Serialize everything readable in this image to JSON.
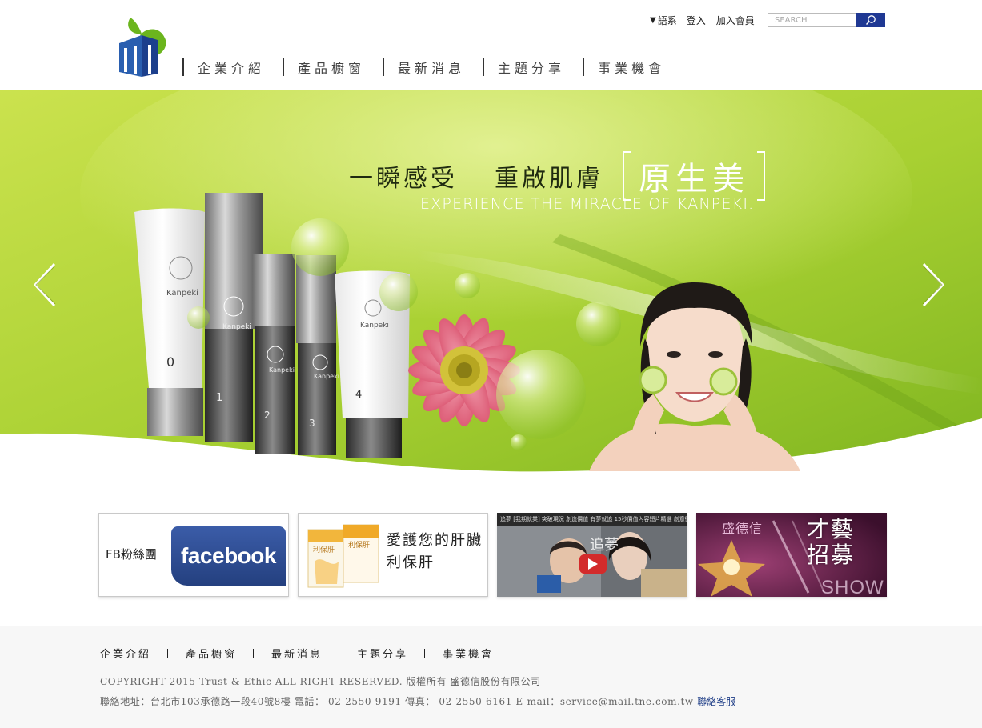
{
  "header": {
    "lang_label": "語系",
    "login_label": "登入",
    "join_label": "加入會員",
    "search_placeholder": "SEARCH"
  },
  "nav": {
    "items": [
      {
        "label": "企業介紹"
      },
      {
        "label": "產品櫥窗"
      },
      {
        "label": "最新消息"
      },
      {
        "label": "主題分享"
      },
      {
        "label": "事業機會"
      }
    ]
  },
  "banner": {
    "headline_1": "一瞬感受",
    "headline_2": "重啟肌膚",
    "headline_box": "原生美",
    "subline": "EXPERIENCE THE MIRACLE OF KANPEKI.",
    "product_brand": "Kanpeki",
    "product_numbers": [
      "0",
      "1",
      "2",
      "3",
      "4"
    ],
    "colors": {
      "green_light": "#c5e04b",
      "green_mid": "#9bc72a",
      "green_dark": "#6aa419"
    }
  },
  "tiles": {
    "fb_label": "FB粉絲團",
    "fb_logo": "facebook",
    "liver_line1": "愛護您的肝臟",
    "liver_line2": "利保肝",
    "liver_product": "利保肝",
    "video_caption": "追夢 [我期就業] 突破現況 創造價值 有夢就追 15秒價值內容短片精選 創意微演講",
    "video_overlay": "追夢",
    "talent_brand": "盛德信",
    "talent_line1": "才藝",
    "talent_line2": "招募",
    "talent_show": "SHOW"
  },
  "footer": {
    "nav": [
      "企業介紹",
      "產品櫥窗",
      "最新消息",
      "主題分享",
      "事業機會"
    ],
    "copyright": "COPYRIGHT 2015 Trust & Ethic ALL RIGHT RESERVED.  版權所有 盛德信股份有限公司",
    "address": "聯絡地址：台北市103承德路一段40號8樓   電話： 02-2550-9191   傳真： 02-2550-6161   E-mail：service@mail.tne.com.tw ",
    "customer_service": "聯絡客服"
  }
}
